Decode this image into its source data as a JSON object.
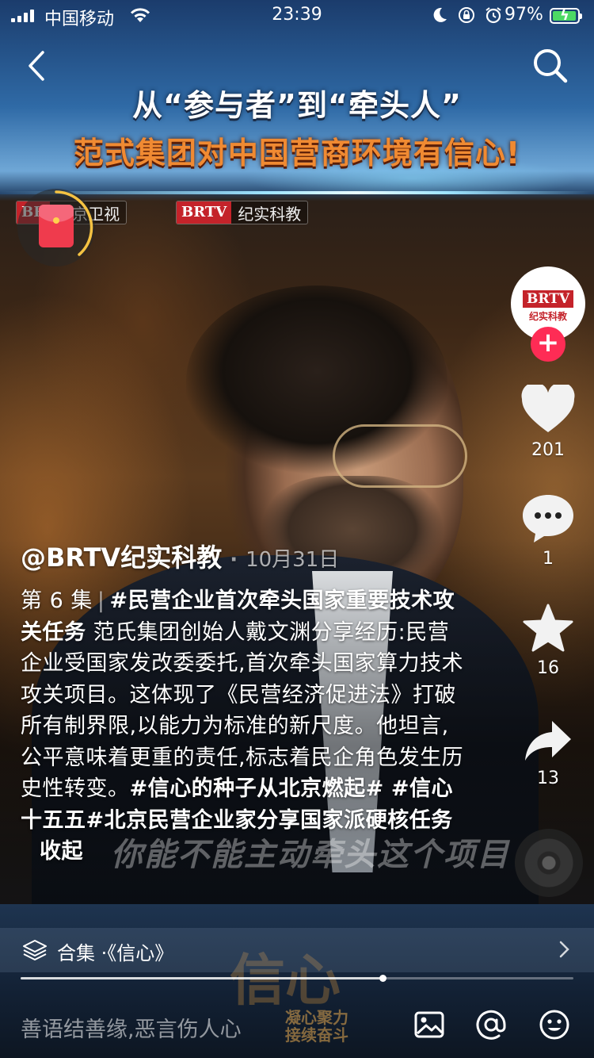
{
  "status_bar": {
    "carrier": "中国移动",
    "time": "23:39",
    "battery_percent": "97%",
    "battery_level": 0.97,
    "icons": [
      "moon-icon",
      "rotation-lock-icon",
      "alarm-icon"
    ]
  },
  "video": {
    "headline_line1": "从“参与者”到“牵头人”",
    "headline_line2": "范式集团对中国营商环境有信心!",
    "channel_bug1_tag": "BR",
    "channel_bug1_name": "北京卫视",
    "channel_bug2_tag": "BRTV",
    "channel_bug2_name": "纪实科教",
    "burned_subtitle": "你能不能主动牵头这个项目",
    "program_logo": "信心",
    "program_logo_sub_line1": "凝心聚力",
    "program_logo_sub_line2": "接续奋斗"
  },
  "creator": {
    "avatar_tag": "BRTV",
    "avatar_sub": "纪实科教",
    "follow_label": "+"
  },
  "actions": {
    "like_count": "201",
    "comment_count": "1",
    "favorite_count": "16",
    "share_count": "13"
  },
  "post": {
    "author": "@BRTV纪实科教",
    "date": "10月31日",
    "episode": "第 6 集",
    "title_tag": "#民营企业首次牵头国家重要技术攻关任务",
    "body": "范氏集团创始人戴文渊分享经历:民营企业受国家发改委委托,首次牵头国家算力技术攻关项目。这体现了《民营经济促进法》打破所有制界限,以能力为标准的新尺度。他坦言,公平意味着更重的责任,标志着民企角色发生历史性转变。",
    "hashtag1": "#信心的种子从北京燃起#",
    "hashtag2": "#信心十五五#北京民营企业家分享国家派硬核任务",
    "collapse_label": "收起"
  },
  "collection": {
    "label": "合集 ·《信心》"
  },
  "playback": {
    "progress": 0.655
  },
  "comment_input": {
    "placeholder": "善语结善缘,恶言伤人心"
  },
  "colors": {
    "accent_red": "#fe2c55",
    "brtv_red": "#c4232a",
    "headline_orange": "#f08a32",
    "battery_green": "#4cd964"
  }
}
